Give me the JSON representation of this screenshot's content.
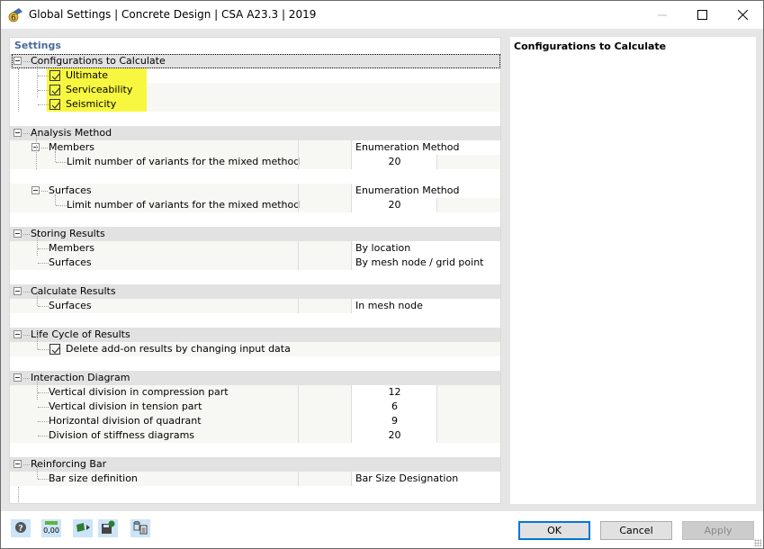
{
  "window": {
    "title": "Global Settings | Concrete Design | CSA A23.3 | 2019",
    "controls": {
      "minimize": "—",
      "maximize": "☐",
      "close": "✕"
    }
  },
  "settings": {
    "header": "Settings",
    "groups": [
      {
        "label": "Configurations to Calculate",
        "items": [
          {
            "label": "Ultimate",
            "checked": true
          },
          {
            "label": "Serviceability",
            "checked": true
          },
          {
            "label": "Seismicity",
            "checked": true
          }
        ]
      },
      {
        "label": "Analysis Method",
        "subgroups": [
          {
            "label": "Members",
            "value": "Enumeration Method",
            "items": [
              {
                "label": "Limit number of variants for the mixed method",
                "value": "20"
              }
            ]
          },
          {
            "label": "Surfaces",
            "value": "Enumeration Method",
            "items": [
              {
                "label": "Limit number of variants for the mixed method",
                "value": "20"
              }
            ]
          }
        ]
      },
      {
        "label": "Storing Results",
        "items": [
          {
            "label": "Members",
            "value": "By location"
          },
          {
            "label": "Surfaces",
            "value": "By mesh node / grid point"
          }
        ]
      },
      {
        "label": "Calculate Results",
        "items": [
          {
            "label": "Surfaces",
            "value": "In mesh node"
          }
        ]
      },
      {
        "label": "Life Cycle of Results",
        "items": [
          {
            "label": "Delete add-on results by changing input data",
            "checked": true
          }
        ]
      },
      {
        "label": "Interaction Diagram",
        "items": [
          {
            "label": "Vertical division in compression part",
            "value": "12"
          },
          {
            "label": "Vertical division in tension part",
            "value": "6"
          },
          {
            "label": "Horizontal division of quadrant",
            "value": "9"
          },
          {
            "label": "Division of stiffness diagrams",
            "value": "20"
          }
        ]
      },
      {
        "label": "Reinforcing Bar",
        "items": [
          {
            "label": "Bar size definition",
            "value": "Bar Size Designation"
          }
        ]
      }
    ]
  },
  "description": {
    "title": "Configurations to Calculate"
  },
  "footer": {
    "tools": [
      {
        "name": "help-icon"
      },
      {
        "name": "units-decimals-icon",
        "text": "0,00"
      },
      {
        "name": "load-settings-icon"
      },
      {
        "name": "save-settings-icon"
      },
      {
        "name": "copy-settings-icon"
      }
    ],
    "buttons": {
      "ok": "OK",
      "cancel": "Cancel",
      "apply": "Apply"
    }
  },
  "colors": {
    "highlight": "#f8f740",
    "accent": "#0078d7",
    "header": "#4a6a9a"
  }
}
